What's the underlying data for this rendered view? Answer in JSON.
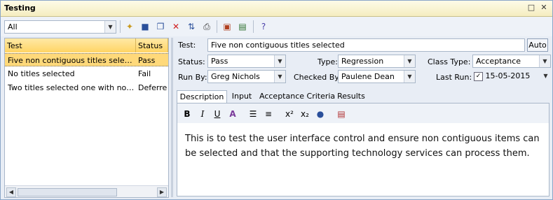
{
  "window": {
    "title": "Testing",
    "restore_glyph": "□",
    "close_glyph": "✕"
  },
  "toolbar": {
    "filter": "All",
    "icons": [
      "new-icon",
      "save-icon",
      "copy-icon",
      "delete-icon",
      "sort-icon",
      "print-icon",
      "hierarchy-icon",
      "report-icon",
      "help-icon"
    ]
  },
  "list": {
    "columns": [
      "Test",
      "Status"
    ],
    "rows": [
      {
        "test": "Five non contiguous titles select...",
        "status": "Pass",
        "selected": true
      },
      {
        "test": "No titles selected",
        "status": "Fail",
        "selected": false
      },
      {
        "test": "Two titles selected one with no s...",
        "status": "Deferred",
        "selected": false
      }
    ]
  },
  "form": {
    "test_label": "Test:",
    "test_value": "Five non contiguous titles selected",
    "auto_label": "Auto",
    "status_label": "Status:",
    "status_value": "Pass",
    "type_label": "Type:",
    "type_value": "Regression",
    "class_type_label": "Class Type:",
    "class_type_value": "Acceptance",
    "run_by_label": "Run By:",
    "run_by_value": "Greg Nichols",
    "checked_by_label": "Checked By:",
    "checked_by_value": "Paulene Dean",
    "last_run_label": "Last Run:",
    "last_run_value": "15-05-2015",
    "last_run_checked": true
  },
  "tabs": [
    "Description",
    "Input",
    "Acceptance Criteria",
    "Results"
  ],
  "editor": {
    "text": "This is to test the user interface control and ensure non contiguous items can be selected and that the supporting technology services can process them."
  },
  "colors": {
    "selection": "#ffd97a",
    "header": "#ffd464",
    "frame": "#8aa6c8"
  }
}
